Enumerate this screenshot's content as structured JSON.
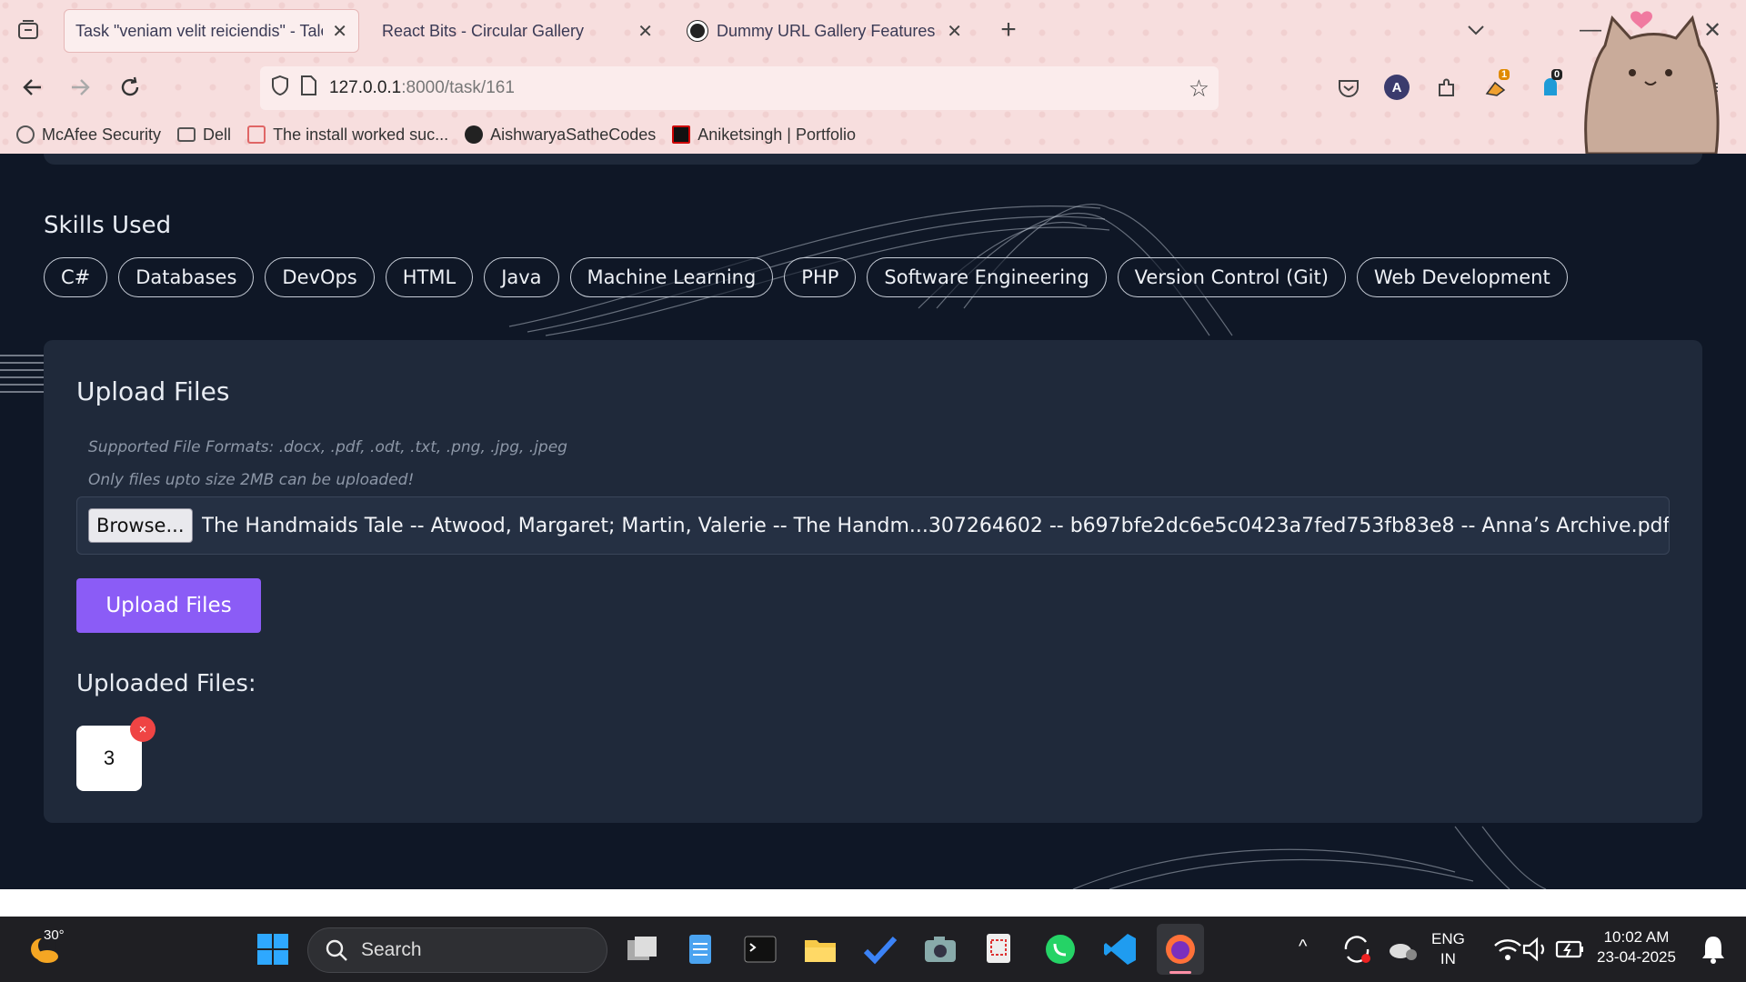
{
  "browser": {
    "tabs": [
      {
        "title": "Task \"veniam velit reiciendis\" - Talen",
        "active": true
      },
      {
        "title": "React Bits - Circular Gallery",
        "active": false
      },
      {
        "title": "Dummy URL Gallery Features",
        "active": false
      }
    ],
    "url": {
      "host": "127.0.0.1",
      "path": ":8000/task/161"
    },
    "bookmarks": [
      {
        "label": "McAfee Security",
        "icon": "globe-icon"
      },
      {
        "label": "Dell",
        "icon": "folder-icon"
      },
      {
        "label": "The install worked suc...",
        "icon": "django-icon"
      },
      {
        "label": "AishwaryaSatheCodes",
        "icon": "github-icon"
      },
      {
        "label": "Aniketsingh | Portfolio",
        "icon": "portfolio-icon"
      }
    ],
    "extension_badges": {
      "first": "1",
      "second": "0"
    }
  },
  "skills": {
    "title": "Skills Used",
    "items": [
      "C#",
      "Databases",
      "DevOps",
      "HTML",
      "Java",
      "Machine Learning",
      "PHP",
      "Software Engineering",
      "Version Control (Git)",
      "Web Development"
    ]
  },
  "upload": {
    "title": "Upload Files",
    "formats_hint": "Supported File Formats: .docx, .pdf, .odt, .txt, .png, .jpg, .jpeg",
    "size_hint": "Only files upto size 2MB can be uploaded!",
    "browse_label": "Browse...",
    "selected_file": "The Handmaids Tale -- Atwood, Margaret; Martin, Valerie -- The Handm...307264602 -- b697bfe2dc6e5c0423a7fed753fb83e8 -- Anna’s Archive.pdf",
    "button_label": "Upload Files",
    "uploaded_title": "Uploaded Files:",
    "uploaded_files": [
      {
        "label": "3"
      }
    ],
    "remove_symbol": "×"
  },
  "taskbar": {
    "temperature": "30°",
    "search_placeholder": "Search",
    "language": "ENG",
    "region": "IN",
    "time": "10:02 AM",
    "date": "23-04-2025"
  },
  "colors": {
    "accent": "#8b5cf6",
    "card": "#1f293a",
    "page": "#0f1726",
    "remove": "#ef4444"
  }
}
